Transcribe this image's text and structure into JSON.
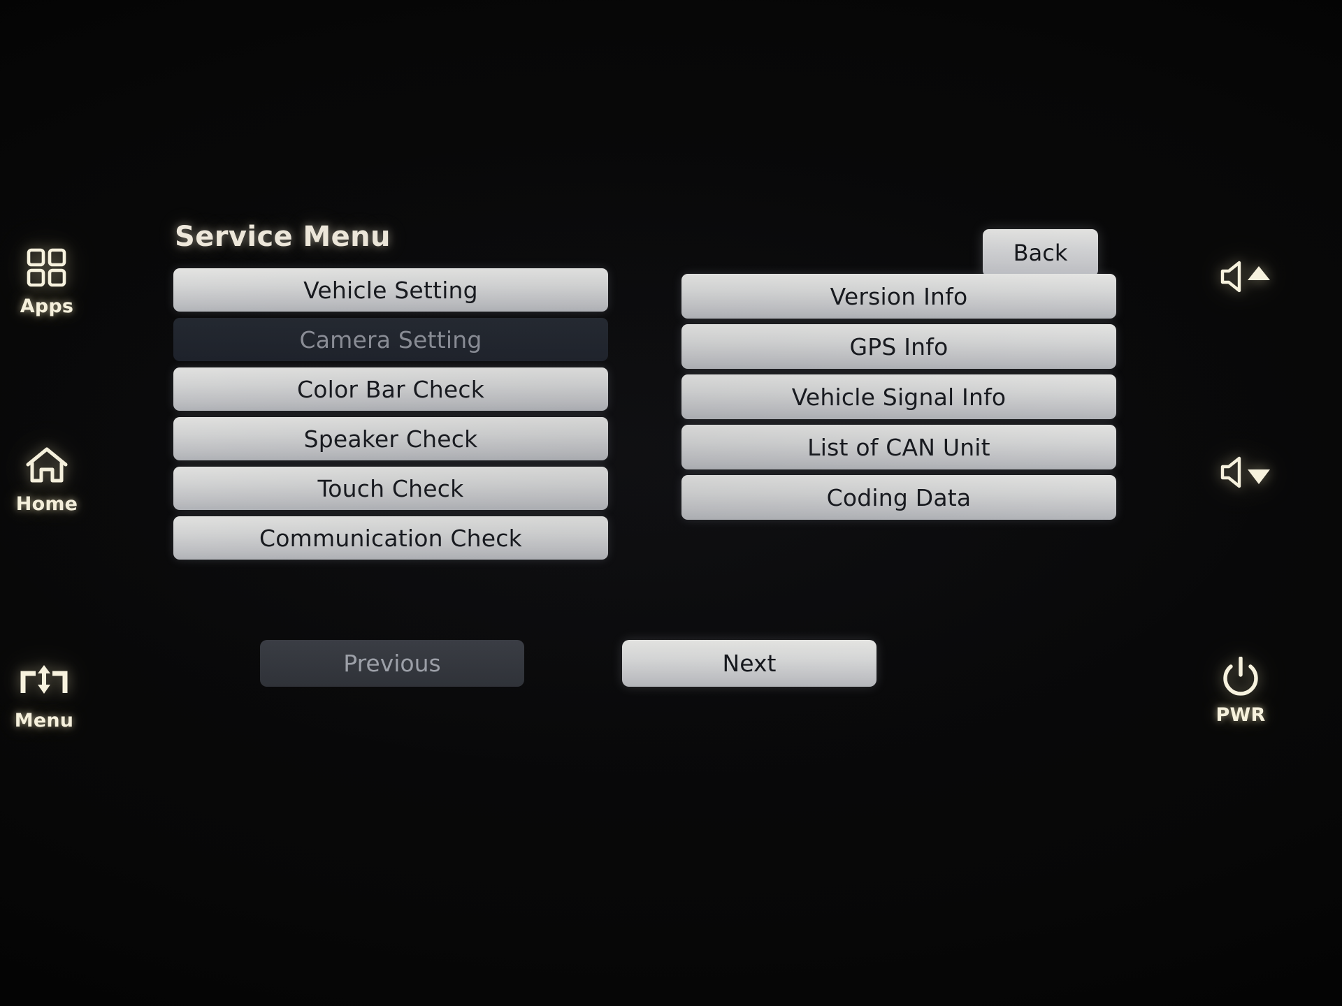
{
  "screen": {
    "title": "Service Menu",
    "back_label": "Back"
  },
  "menu": {
    "left_column": [
      {
        "label": "Vehicle Setting",
        "state": "enabled"
      },
      {
        "label": "Camera Setting",
        "state": "disabled"
      },
      {
        "label": "Color Bar Check",
        "state": "enabled"
      },
      {
        "label": "Speaker Check",
        "state": "enabled"
      },
      {
        "label": "Touch Check",
        "state": "enabled"
      },
      {
        "label": "Communication Check",
        "state": "enabled"
      }
    ],
    "right_column": [
      {
        "label": "Version Info",
        "state": "enabled"
      },
      {
        "label": "GPS Info",
        "state": "enabled"
      },
      {
        "label": "Vehicle Signal Info",
        "state": "enabled"
      },
      {
        "label": "List of CAN Unit",
        "state": "enabled"
      },
      {
        "label": "Coding Data",
        "state": "enabled"
      }
    ]
  },
  "pagination": {
    "previous_label": "Previous",
    "previous_state": "disabled",
    "next_label": "Next",
    "next_state": "enabled"
  },
  "hardware_keys": {
    "left": [
      {
        "icon": "apps-grid-icon",
        "label": "Apps"
      },
      {
        "icon": "home-icon",
        "label": "Home"
      },
      {
        "icon": "menu-updown-icon",
        "label": "Menu"
      }
    ],
    "right": [
      {
        "icon": "volume-up-icon",
        "label": ""
      },
      {
        "icon": "volume-down-icon",
        "label": ""
      },
      {
        "icon": "power-icon",
        "label": "PWR"
      }
    ]
  },
  "colors": {
    "background": "#000000",
    "button_face": "#d6d7d7",
    "button_text": "#16181d",
    "disabled_face": "#232830",
    "disabled_text": "#8d9099",
    "title_text": "#efe9dc",
    "hardware_key_glow": "#f6f1dd"
  }
}
